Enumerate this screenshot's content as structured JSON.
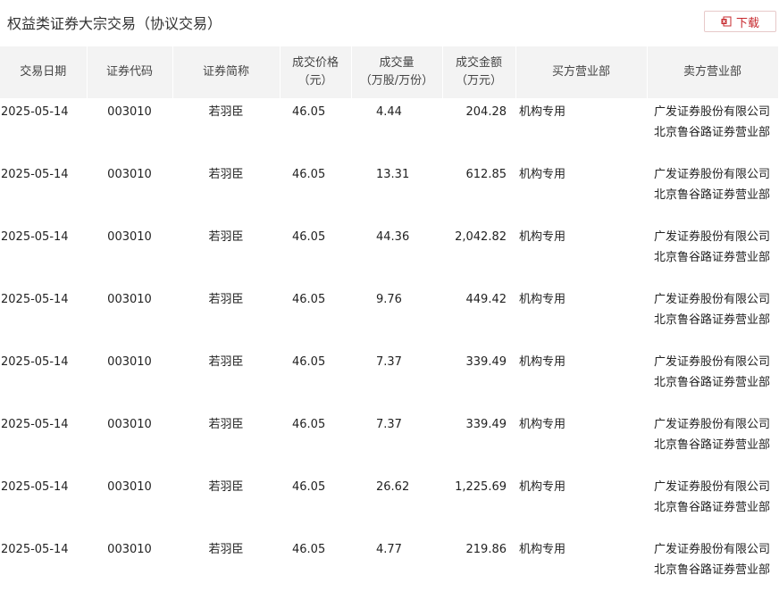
{
  "page": {
    "title": "权益类证券大宗交易（协议交易）",
    "download_label": "下载"
  },
  "table": {
    "headers": [
      [
        "交易日期"
      ],
      [
        "证券代码"
      ],
      [
        "证券简称"
      ],
      [
        "成交价格",
        "（元）"
      ],
      [
        "成交量",
        "（万股/万份）"
      ],
      [
        "成交金额",
        "（万元）"
      ],
      [
        "买方营业部"
      ],
      [
        "卖方营业部"
      ]
    ],
    "rows": [
      {
        "date": "2025-05-14",
        "code": "003010",
        "name": "若羽臣",
        "price": "46.05",
        "volume": "4.44",
        "amount": "204.28",
        "buyer": "机构专用",
        "seller": "广发证券股份有限公司北京鲁谷路证券营业部"
      },
      {
        "date": "2025-05-14",
        "code": "003010",
        "name": "若羽臣",
        "price": "46.05",
        "volume": "13.31",
        "amount": "612.85",
        "buyer": "机构专用",
        "seller": "广发证券股份有限公司北京鲁谷路证券营业部"
      },
      {
        "date": "2025-05-14",
        "code": "003010",
        "name": "若羽臣",
        "price": "46.05",
        "volume": "44.36",
        "amount": "2,042.82",
        "buyer": "机构专用",
        "seller": "广发证券股份有限公司北京鲁谷路证券营业部"
      },
      {
        "date": "2025-05-14",
        "code": "003010",
        "name": "若羽臣",
        "price": "46.05",
        "volume": "9.76",
        "amount": "449.42",
        "buyer": "机构专用",
        "seller": "广发证券股份有限公司北京鲁谷路证券营业部"
      },
      {
        "date": "2025-05-14",
        "code": "003010",
        "name": "若羽臣",
        "price": "46.05",
        "volume": "7.37",
        "amount": "339.49",
        "buyer": "机构专用",
        "seller": "广发证券股份有限公司北京鲁谷路证券营业部"
      },
      {
        "date": "2025-05-14",
        "code": "003010",
        "name": "若羽臣",
        "price": "46.05",
        "volume": "7.37",
        "amount": "339.49",
        "buyer": "机构专用",
        "seller": "广发证券股份有限公司北京鲁谷路证券营业部"
      },
      {
        "date": "2025-05-14",
        "code": "003010",
        "name": "若羽臣",
        "price": "46.05",
        "volume": "26.62",
        "amount": "1,225.69",
        "buyer": "机构专用",
        "seller": "广发证券股份有限公司北京鲁谷路证券营业部"
      },
      {
        "date": "2025-05-14",
        "code": "003010",
        "name": "若羽臣",
        "price": "46.05",
        "volume": "4.77",
        "amount": "219.86",
        "buyer": "机构专用",
        "seller": "广发证券股份有限公司北京鲁谷路证券营业部"
      }
    ]
  },
  "colors": {
    "accent": "#c7282d",
    "header_bg": "#f3f3f3"
  },
  "icons": {
    "download": "excel-download-icon"
  }
}
